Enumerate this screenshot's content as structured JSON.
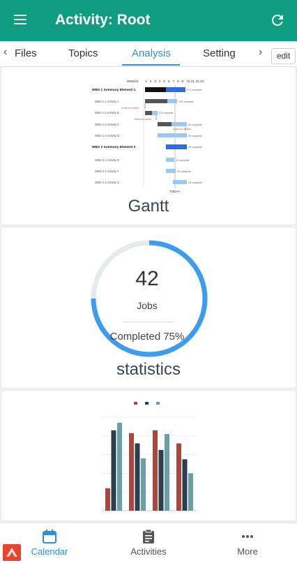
{
  "header": {
    "title": "Activity: Root",
    "menu_icon": "menu-icon",
    "refresh_icon": "refresh-icon"
  },
  "tabs": [
    {
      "label": "Files"
    },
    {
      "label": "Topics"
    },
    {
      "label": "Analysis",
      "active": true
    },
    {
      "label": "Setting"
    }
  ],
  "tab_scroll": {
    "left": "‹",
    "right": "›"
  },
  "edit_button": {
    "label": "edit"
  },
  "gantt_card": {
    "title": "Gantt",
    "weeks_label": "WEEKS:",
    "weeks": [
      "1",
      "2",
      "3",
      "4",
      "5",
      "6",
      "7",
      "8",
      "9",
      "10",
      "21",
      "22",
      "23"
    ],
    "today_label": "TODAY",
    "rows": [
      {
        "label": "WBS 1 Summary Element 1",
        "bold": true,
        "complete": "57% complete"
      },
      {
        "label": "WBS 1.1 Activity A",
        "complete": "75% complete"
      },
      {
        "label": "WBS 1.2 Activity B",
        "complete": "27% complete"
      },
      {
        "label": "WBS 1.3 Activity C",
        "complete": "0% complete"
      },
      {
        "label": "WBS 1.4 Activity D",
        "complete": "0% complete"
      },
      {
        "label": "WBS 2 Summary Element 2",
        "bold": true,
        "complete": "0% complete"
      },
      {
        "label": "WBS 2.1 Activity E",
        "complete": "0% complete"
      },
      {
        "label": "WBS 2.2 Activity F",
        "complete": "0% complete"
      },
      {
        "label": "WBS 2.3 Activity G",
        "complete": "0% complete"
      }
    ],
    "dependency_labels": [
      "START-TO-START",
      "FINISH-TO-START",
      "FINISH-TO-FINISH"
    ]
  },
  "stats_card": {
    "title": "statistics",
    "value": "42",
    "unit": "Jobs",
    "completed_text": "Completed 75%",
    "progress": 0.75,
    "colors": {
      "ring": "#3e9cf0",
      "track": "#e6e9ee"
    }
  },
  "chart_data": {
    "type": "bar",
    "categories": [
      "",
      "",
      "",
      ""
    ],
    "series": [
      {
        "name": "",
        "color": "#b2433a",
        "values": [
          24,
          83,
          86,
          72
        ]
      },
      {
        "name": "",
        "color": "#2e3e4f",
        "values": [
          86,
          72,
          65,
          55
        ]
      },
      {
        "name": "",
        "color": "#6e9ea3",
        "values": [
          94,
          56,
          82,
          40
        ]
      }
    ],
    "ylim": [
      0,
      100
    ],
    "grid": true,
    "legend": "top"
  },
  "bottom_nav": [
    {
      "label": "Calendar",
      "icon": "calendar-icon",
      "active": true
    },
    {
      "label": "Activities",
      "icon": "clipboard-icon"
    },
    {
      "label": "More",
      "icon": "more-icon"
    }
  ],
  "colors": {
    "header": "#0f9d82",
    "accent": "#2f8fd8"
  }
}
